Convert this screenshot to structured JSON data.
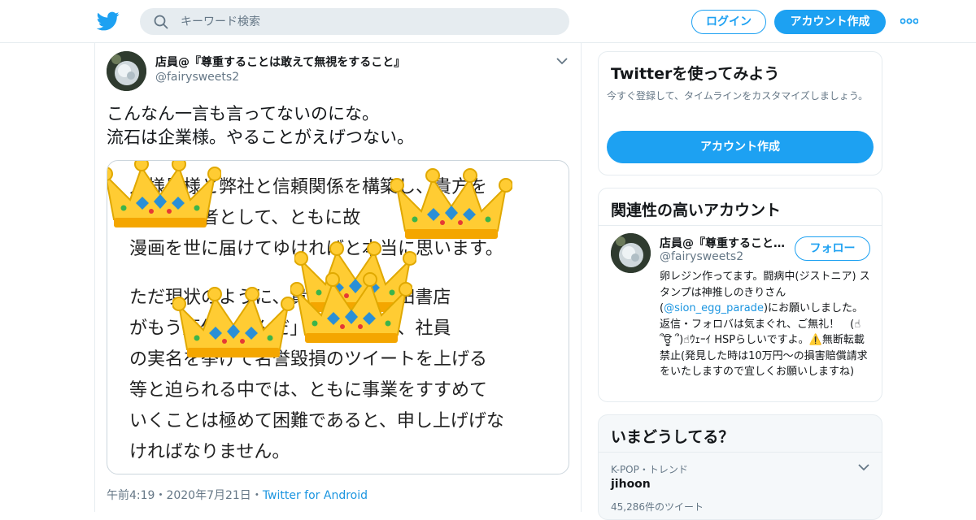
{
  "header": {
    "search_placeholder": "キーワード検索",
    "login_label": "ログイン",
    "signup_label": "アカウント作成"
  },
  "tweet": {
    "author_name": "店員@『尊重することは敢えて無視をすること』",
    "author_handle": "@fairysweets2",
    "text_lines": [
      "こんなん一言も言ってないのにな。",
      "流石は企業様。やることがえげつない。"
    ],
    "image_text": {
      "para1": [
        "人様曼様と弊社と信頼関係を構築し、貴方を",
        "権利継承者として、ともに故　　　先生の",
        "漫画を世に届けてゆければと本当に思います。"
      ],
      "para2": [
        "ただ現状のように、貴方から「秋田書店",
        "がもう原作を盗んだ」と指弾され、社員",
        "の実名を挙げて名誉毀損のツイートを上げる",
        "等と迫られる中では、ともに事業をすすめて",
        "いくことは極めて困難であると、申し上げげな",
        "ければなりません。"
      ]
    },
    "time": "午前4:19",
    "date": "2020年7月21日",
    "sep": "・",
    "source": "Twitter for Android"
  },
  "sidebar": {
    "try": {
      "title": "Twitterを使ってみよう",
      "desc": "今すぐ登録して、タイムラインをカスタマイズしましょう。",
      "button": "アカウント作成"
    },
    "related": {
      "title": "関連性の高いアカウント",
      "name": "店員@『尊重することは敢えて無視をすること』",
      "handle": "@fairysweets2",
      "follow": "フォロー",
      "bio_1": "卵レジン作ってます。闘病中(ジストニア) スタンプは神推しのきりさん(",
      "mention": "@sion_egg_parade",
      "bio_2": ")にお願いしました。 返信・フォロバは気まぐれ、ご無礼！　(☝ ՞ਊ ՞)☝ｳｪｰｲ HSPらしいですよ。⚠️無断転載禁止(発見した時は10万円〜の損害賠償請求をいたしますので宜しくお願いしますね)"
    },
    "trends": {
      "title": "いまどうしてる？",
      "meta": "K-POP・トレンド",
      "name": "jihoon",
      "count": "45,286件のツイート"
    }
  },
  "colors": {
    "accent": "#1da1f2",
    "link": "#1b95e0",
    "border": "#e6ecf0",
    "muted": "#657786"
  },
  "icons": [
    "twitter-bird-icon",
    "search-icon",
    "more-dots-icon",
    "chevron-down-icon",
    "crown-emoji",
    "warning-icon"
  ]
}
